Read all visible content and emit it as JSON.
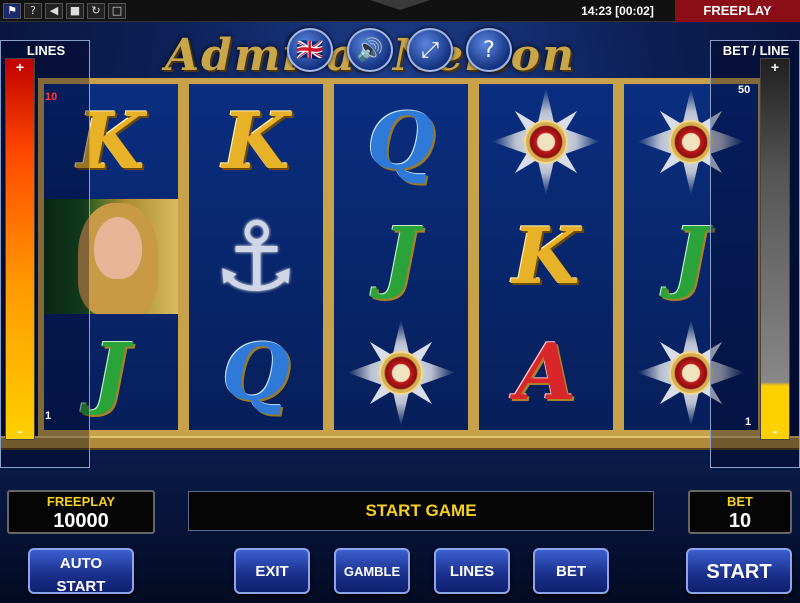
{
  "topbar": {
    "buttons": [
      {
        "name": "flag-icon",
        "glyph": "⚑"
      },
      {
        "name": "help-icon",
        "glyph": "?"
      },
      {
        "name": "sound-icon",
        "glyph": "◀"
      },
      {
        "name": "window-icon",
        "glyph": "■"
      },
      {
        "name": "refresh-icon",
        "glyph": "↻"
      },
      {
        "name": "fullscreen-icon",
        "glyph": "□"
      }
    ],
    "clock": "14:23 [00:02]",
    "mode": "FREEPLAY"
  },
  "header": {
    "logo": "Admiral Nelson",
    "icons": {
      "language": "🇬🇧",
      "sound": "🔊",
      "fullscreen": "⤢",
      "help": "?"
    }
  },
  "lines_panel": {
    "title": "LINES",
    "plus": "+",
    "minus": "-",
    "max": "10",
    "min": "1"
  },
  "bet_panel": {
    "title": "BET / LINE",
    "plus": "+",
    "minus": "-",
    "max": "50",
    "min": "1"
  },
  "reels": [
    [
      {
        "type": "letter",
        "text": "K",
        "color": "gold"
      },
      {
        "type": "portrait"
      },
      {
        "type": "letter",
        "text": "J",
        "color": "green"
      }
    ],
    [
      {
        "type": "letter",
        "text": "K",
        "color": "gold"
      },
      {
        "type": "anchor",
        "text": "⚓"
      },
      {
        "type": "letter",
        "text": "Q",
        "color": "blue"
      }
    ],
    [
      {
        "type": "letter",
        "text": "Q",
        "color": "blue"
      },
      {
        "type": "letter",
        "text": "J",
        "color": "green"
      },
      {
        "type": "star"
      }
    ],
    [
      {
        "type": "star"
      },
      {
        "type": "letter",
        "text": "K",
        "color": "gold"
      },
      {
        "type": "letter",
        "text": "A",
        "color": "red"
      }
    ],
    [
      {
        "type": "star"
      },
      {
        "type": "letter",
        "text": "J",
        "color": "green"
      },
      {
        "type": "star"
      }
    ]
  ],
  "bottom": {
    "freeplay_label": "FREEPLAY",
    "freeplay_value": "10000",
    "message": "START GAME",
    "bet_label": "BET",
    "bet_value": "10",
    "buttons": {
      "auto_start_1": "AUTO",
      "auto_start_2": "START",
      "exit": "EXIT",
      "gamble": "GAMBLE",
      "lines": "LINES",
      "bet": "BET",
      "start": "START"
    }
  }
}
